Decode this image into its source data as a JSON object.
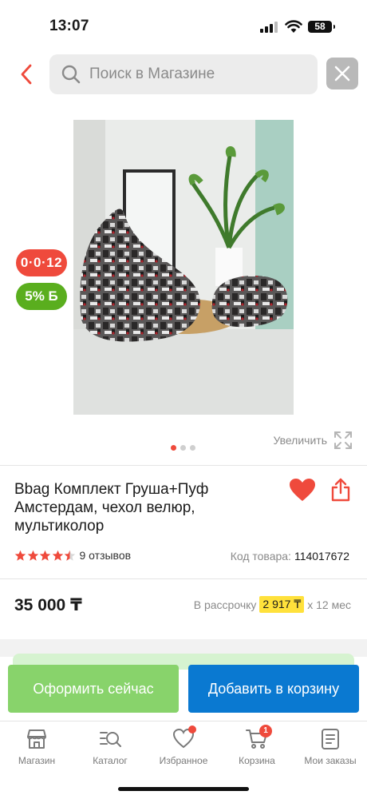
{
  "status_bar": {
    "time": "13:07",
    "battery": "58"
  },
  "header": {
    "search_placeholder": "Поиск в Магазине"
  },
  "badges": {
    "timer": "0·0·12",
    "bonus": "5% Б"
  },
  "gallery": {
    "zoom_label": "Увеличить",
    "total_images": 3,
    "active_index": 0
  },
  "product": {
    "title": "Bbag Комплект Груша+Пуф Амстердам, чехол велюр, мультиколор",
    "rating": 4.5,
    "reviews": "9 отзывов",
    "sku_label": "Код товара:",
    "sku_value": "114017672",
    "price": "35 000 ₸",
    "installment_prefix": "В рассрочку",
    "installment_amount": "2 917 ₸",
    "installment_suffix": "х 12 мес"
  },
  "actions": {
    "checkout": "Оформить сейчас",
    "add_to_cart": "Добавить в корзину"
  },
  "nav": {
    "items": [
      {
        "label": "Магазин"
      },
      {
        "label": "Каталог"
      },
      {
        "label": "Избранное"
      },
      {
        "label": "Корзина",
        "badge": "1"
      },
      {
        "label": "Мои заказы"
      }
    ]
  },
  "colors": {
    "accent_red": "#ef4a3c",
    "bonus_green": "#5aae1e",
    "checkout_green": "#88d36b",
    "cart_blue": "#0a79d1",
    "installment_yellow": "#ffe13b"
  }
}
